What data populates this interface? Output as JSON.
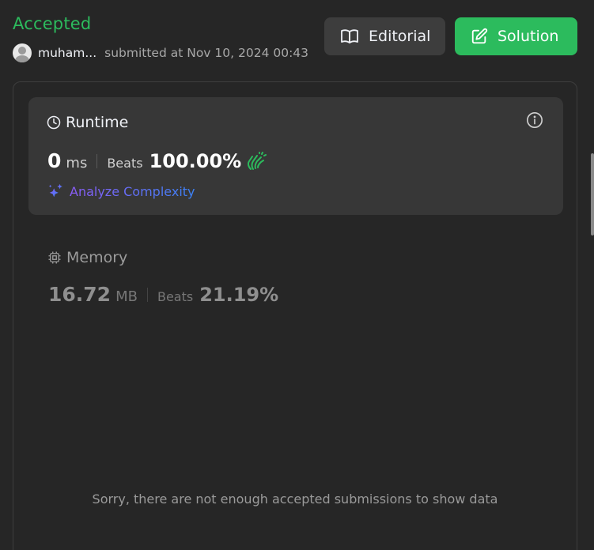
{
  "header": {
    "status": "Accepted",
    "username": "muham...",
    "submitted_text": "submitted at Nov 10, 2024 00:43"
  },
  "buttons": {
    "editorial_label": "Editorial",
    "solution_label": "Solution"
  },
  "runtime": {
    "title": "Runtime",
    "value": "0",
    "unit": "ms",
    "beats_label": "Beats",
    "beats_value": "100.00%",
    "analyze_label": "Analyze Complexity"
  },
  "memory": {
    "title": "Memory",
    "value": "16.72",
    "unit": "MB",
    "beats_label": "Beats",
    "beats_value": "21.19%"
  },
  "empty_message": "Sorry, there are not enough accepted submissions to show data",
  "colors": {
    "accent": "#2cbb5d",
    "background": "#262626",
    "card": "#373737"
  },
  "icons": [
    "book-icon",
    "edit-icon",
    "clock-icon",
    "info-icon",
    "clap-icon",
    "sparkle-icon",
    "chip-icon",
    "avatar"
  ]
}
